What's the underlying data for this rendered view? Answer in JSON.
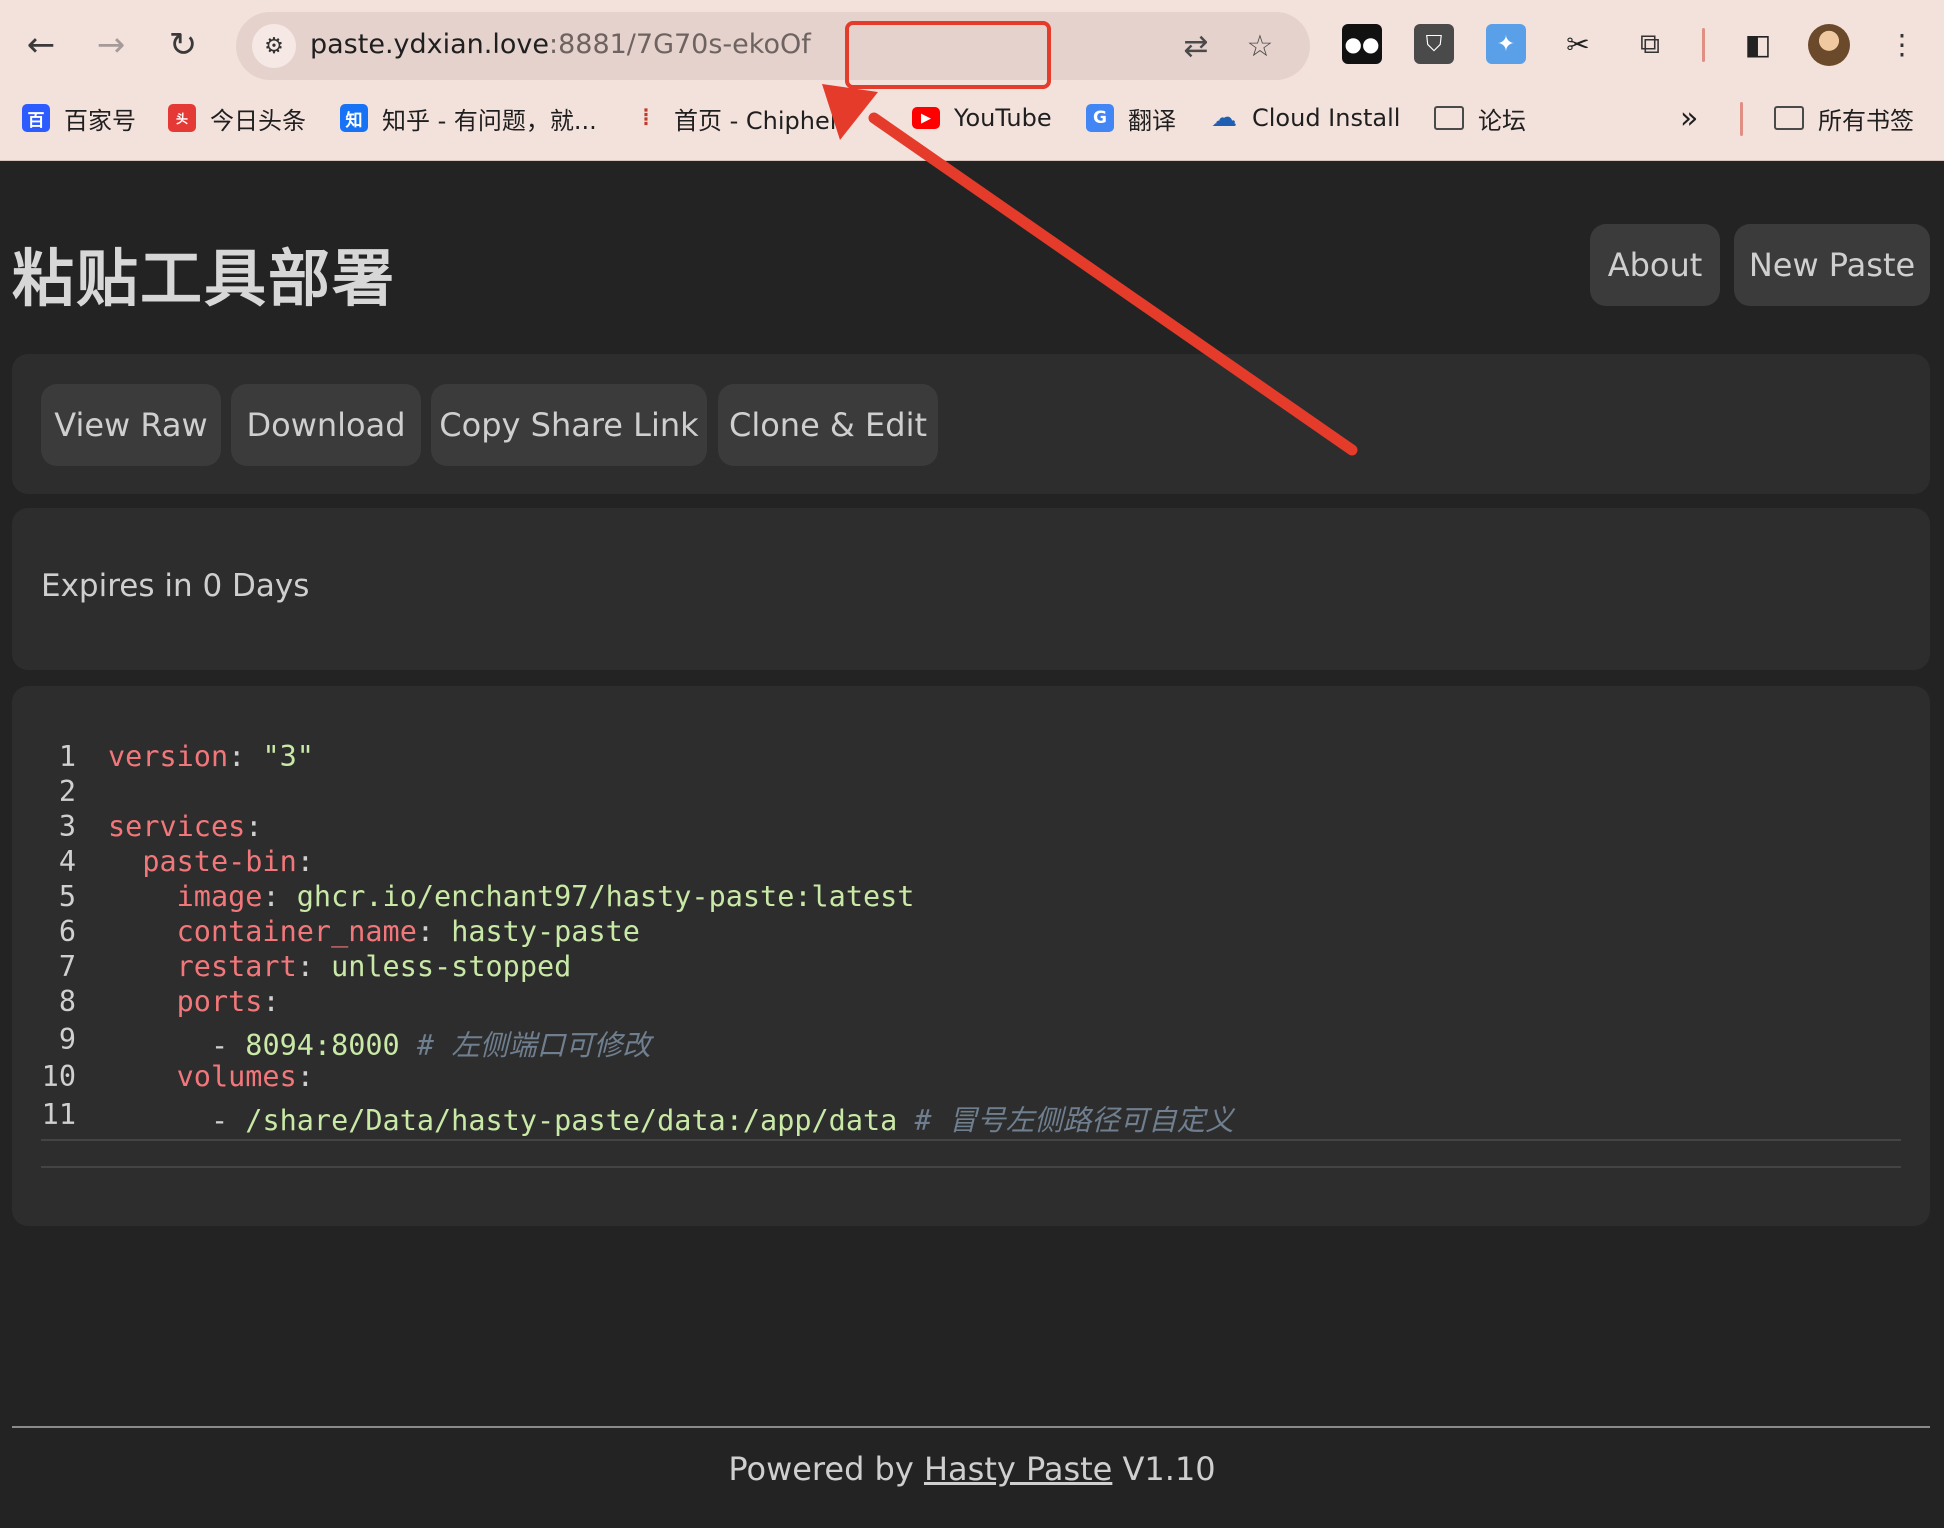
{
  "browser": {
    "url_host": "paste.ydxian.love",
    "url_port": ":8881",
    "url_path": "/7G70s-ekoOf",
    "bookmarks": [
      {
        "label": "百家号",
        "icon": "baijiahao-icon",
        "color": "#2c5bff"
      },
      {
        "label": "今日头条",
        "icon": "toutiao-icon",
        "color": "#e53935"
      },
      {
        "label": "知乎 - 有问题，就...",
        "icon": "zhihu-icon",
        "color": "#1772f6"
      },
      {
        "label": "首页 - Chiphell",
        "icon": "chiphell-icon",
        "color": "#c0392b"
      },
      {
        "label": "YouTube",
        "icon": "youtube-icon",
        "color": "#ff0000"
      },
      {
        "label": "翻译",
        "icon": "google-translate-icon",
        "color": "#4285f4"
      },
      {
        "label": "Cloud Install",
        "icon": "cloud-icon",
        "color": "#1e5fb3"
      },
      {
        "label": "论坛",
        "icon": "folder-icon",
        "color": "#4a4a4a"
      }
    ],
    "overflow_label": "»",
    "all_bookmarks_label": "所有书签"
  },
  "header": {
    "title": "粘贴工具部署",
    "about_label": "About",
    "new_paste_label": "New Paste"
  },
  "toolbar": {
    "view_raw_label": "View Raw",
    "download_label": "Download",
    "copy_share_label": "Copy Share Link",
    "clone_edit_label": "Clone & Edit"
  },
  "meta": {
    "expires_text": "Expires in 0 Days"
  },
  "code": {
    "lines": [
      {
        "n": "1",
        "indent": "",
        "key": "version",
        "sep": ": ",
        "value": "\"3\"",
        "comment": "",
        "kind": "string"
      },
      {
        "n": "2",
        "indent": "",
        "key": "",
        "sep": "",
        "value": "",
        "comment": "",
        "kind": "blank"
      },
      {
        "n": "3",
        "indent": "",
        "key": "services",
        "sep": ":",
        "value": "",
        "comment": "",
        "kind": "key"
      },
      {
        "n": "4",
        "indent": "  ",
        "key": "paste-bin",
        "sep": ":",
        "value": "",
        "comment": "",
        "kind": "key"
      },
      {
        "n": "5",
        "indent": "    ",
        "key": "image",
        "sep": ": ",
        "value": "ghcr.io/enchant97/hasty-paste:latest",
        "comment": "",
        "kind": "value"
      },
      {
        "n": "6",
        "indent": "    ",
        "key": "container_name",
        "sep": ": ",
        "value": "hasty-paste",
        "comment": "",
        "kind": "value"
      },
      {
        "n": "7",
        "indent": "    ",
        "key": "restart",
        "sep": ": ",
        "value": "unless-stopped",
        "comment": "",
        "kind": "value"
      },
      {
        "n": "8",
        "indent": "    ",
        "key": "ports",
        "sep": ":",
        "value": "",
        "comment": "",
        "kind": "key"
      },
      {
        "n": "9",
        "indent": "      ",
        "key": "",
        "sep": "- ",
        "value": "8094:8000",
        "comment": "# 左侧端口可修改",
        "kind": "list"
      },
      {
        "n": "10",
        "indent": "    ",
        "key": "volumes",
        "sep": ":",
        "value": "",
        "comment": "",
        "kind": "key"
      },
      {
        "n": "11",
        "indent": "      ",
        "key": "",
        "sep": "- ",
        "value": "/share/Data/hasty-paste/data:/app/data",
        "comment": "# 冒号左侧路径可自定义",
        "kind": "list"
      }
    ]
  },
  "footer": {
    "prefix": "Powered by ",
    "link_label": "Hasty Paste",
    "suffix": " V1.10"
  },
  "colors": {
    "annotation": "#e53b2a",
    "yaml_key": "#f2777a",
    "yaml_value": "#c9e9a6",
    "yaml_comment": "#6f7f8f"
  }
}
